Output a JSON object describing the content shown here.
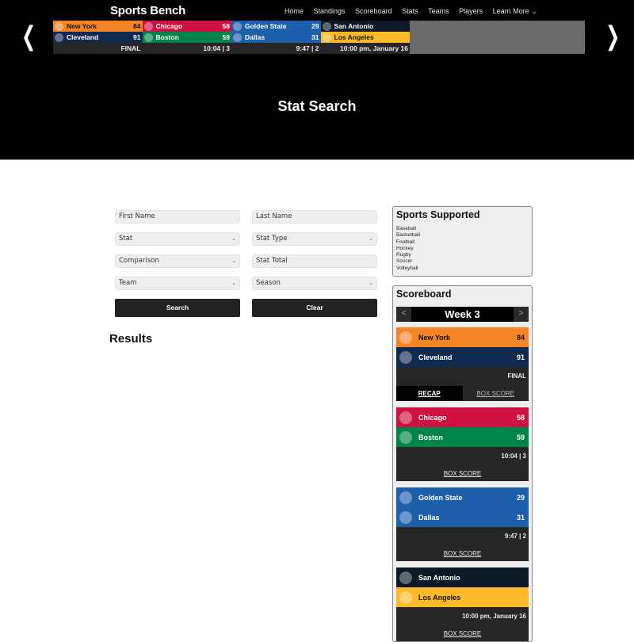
{
  "header": {
    "brand": "Sports Bench",
    "nav": [
      "Home",
      "Standings",
      "Scoreboard",
      "Stats",
      "Teams",
      "Players",
      "Learn More"
    ],
    "page_title": "Stat Search"
  },
  "ticker": [
    {
      "away": {
        "name": "New York",
        "score": "84",
        "color": "#f58426"
      },
      "home": {
        "name": "Cleveland",
        "score": "91",
        "color": "#0f2a4e"
      },
      "status": "FINAL"
    },
    {
      "away": {
        "name": "Chicago",
        "score": "58",
        "color": "#ce1141"
      },
      "home": {
        "name": "Boston",
        "score": "59",
        "color": "#008348"
      },
      "status": "10:04 | 3"
    },
    {
      "away": {
        "name": "Golden State",
        "score": "29",
        "color": "#1d5faa"
      },
      "home": {
        "name": "Dallas",
        "score": "31",
        "color": "#1d5faa"
      },
      "status": "9:47 | 2"
    },
    {
      "away": {
        "name": "San Antonio",
        "score": "",
        "color": "#0b1a26"
      },
      "home": {
        "name": "Los Angeles",
        "score": "",
        "color": "#fdb927"
      },
      "status": "10:00 pm, January 16"
    }
  ],
  "form": {
    "first_name_placeholder": "First Name",
    "last_name_placeholder": "Last Name",
    "stat": "Stat",
    "stat_type": "Stat Type",
    "comparison": "Comparison",
    "stat_total_placeholder": "Stat Total",
    "team": "Team",
    "season": "Season",
    "search_label": "Search",
    "clear_label": "Clear"
  },
  "results_heading": "Results",
  "sports_supported": {
    "title": "Sports Supported",
    "items": [
      "Baseball",
      "Basketball",
      "Football",
      "Hockey",
      "Rugby",
      "Soccer",
      "Volleyball"
    ]
  },
  "scoreboard": {
    "title": "Scoreboard",
    "week": "Week 3",
    "prev": "<",
    "next": ">",
    "recap_label": "RECAP",
    "box_score_label": "BOX SCORE",
    "games": [
      {
        "away": {
          "name": "New York",
          "score": "84",
          "color": "#f58426"
        },
        "home": {
          "name": "Cleveland",
          "score": "91",
          "color": "#0f2a4e"
        },
        "status": "FINAL"
      },
      {
        "away": {
          "name": "Chicago",
          "score": "58",
          "color": "#ce1141"
        },
        "home": {
          "name": "Boston",
          "score": "59",
          "color": "#008348"
        },
        "status": "10:04 | 3"
      },
      {
        "away": {
          "name": "Golden State",
          "score": "29",
          "color": "#1d5faa"
        },
        "home": {
          "name": "Dallas",
          "score": "31",
          "color": "#1d5faa"
        },
        "status": "9:47 | 2"
      },
      {
        "away": {
          "name": "San Antonio",
          "score": "",
          "color": "#0b1a26"
        },
        "home": {
          "name": "Los Angeles",
          "score": "",
          "color": "#fdb927"
        },
        "status": "10:00 pm, January 16"
      }
    ]
  }
}
